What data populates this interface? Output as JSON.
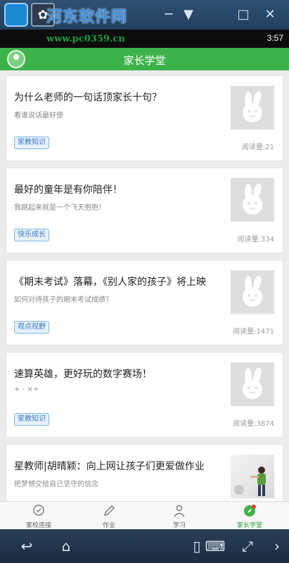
{
  "emulator": {
    "app_icon": "bunny-icon",
    "minimize": "─",
    "restore": "▼",
    "maximize": "□",
    "close": "✕"
  },
  "watermark": {
    "title": "河东软件网",
    "url": "www.pc0359.cn"
  },
  "statusbar": {
    "time": "3:57"
  },
  "header": {
    "title": "家长学堂"
  },
  "articles": [
    {
      "title": "为什么老师的一句话顶家长十句？",
      "subtitle": "看谁说话最好使",
      "tag": "家教知识",
      "reads": "阅读量:21",
      "thumb": "placeholder"
    },
    {
      "title": "最好的童年是有你陪伴！",
      "subtitle": "我跳起来就是一个飞天抱抱！",
      "tag": "快乐成长",
      "reads": "阅读量:334",
      "thumb": "placeholder"
    },
    {
      "title": "《期末考试》落幕，《别人家的孩子》将上映",
      "subtitle": "如何对待孩子的期末考试成绩？",
      "tag": "观点视野",
      "reads": "阅读量:1471",
      "thumb": "placeholder"
    },
    {
      "title": "速算英雄，更好玩的数字赛场！",
      "subtitle": "+ - ×÷",
      "tag": "家教知识",
      "reads": "阅读量:3874",
      "thumb": "placeholder"
    },
    {
      "title": "星教师|胡晴颖：向上网让孩子们更爱做作业",
      "subtitle": "把梦想交给自己坚守的信念",
      "tag": "",
      "reads": "",
      "thumb": "photo"
    }
  ],
  "nav": [
    {
      "label": "家校连接",
      "icon": "chat-icon",
      "active": false
    },
    {
      "label": "作业",
      "icon": "pencil-icon",
      "active": false
    },
    {
      "label": "学习",
      "icon": "person-icon",
      "active": false
    },
    {
      "label": "家长学堂",
      "icon": "compass-icon",
      "active": true
    }
  ],
  "colors": {
    "accent": "#3db24a",
    "tag_border": "#7fb2e6",
    "tag_text": "#3a78c2"
  }
}
